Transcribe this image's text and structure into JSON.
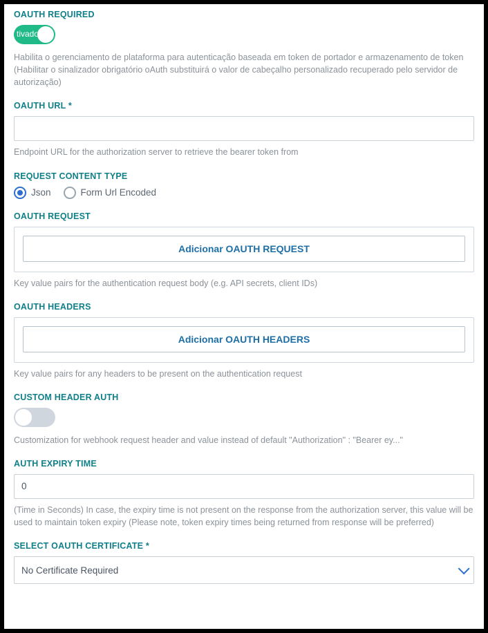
{
  "oauthRequired": {
    "label": "OAUTH REQUIRED",
    "toggleText": "tivado",
    "help": "Habilita o gerenciamento de plataforma para autenticação baseada em token de portador e armazenamento de token (Habilitar o sinalizador obrigatório oAuth substituirá o valor de cabeçalho personalizado recuperado pelo servidor de autorização)"
  },
  "oauthUrl": {
    "label": "OAUTH URL *",
    "value": "",
    "help": "Endpoint URL for the authorization server to retrieve the bearer token from"
  },
  "requestContentType": {
    "label": "REQUEST CONTENT TYPE",
    "options": {
      "json": "Json",
      "form": "Form Url Encoded"
    }
  },
  "oauthRequest": {
    "label": "OAUTH REQUEST",
    "button": "Adicionar OAUTH REQUEST",
    "help": "Key value pairs for the authentication request body (e.g. API secrets, client IDs)"
  },
  "oauthHeaders": {
    "label": "OAUTH HEADERS",
    "button": "Adicionar OAUTH HEADERS",
    "help": "Key value pairs for any headers to be present on the authentication request"
  },
  "customHeaderAuth": {
    "label": "CUSTOM HEADER AUTH",
    "help": "Customization for webhook request header and value instead of default \"Authorization\" : \"Bearer ey...\""
  },
  "authExpiry": {
    "label": "AUTH EXPIRY TIME",
    "value": "0",
    "help": "(Time in Seconds) In case, the expiry time is not present on the response from the authorization server, this value will be used to maintain token expiry (Please note, token expiry times being returned from response will be preferred)"
  },
  "selectCert": {
    "label": "SELECT OAUTH CERTIFICATE *",
    "value": "No Certificate Required"
  }
}
